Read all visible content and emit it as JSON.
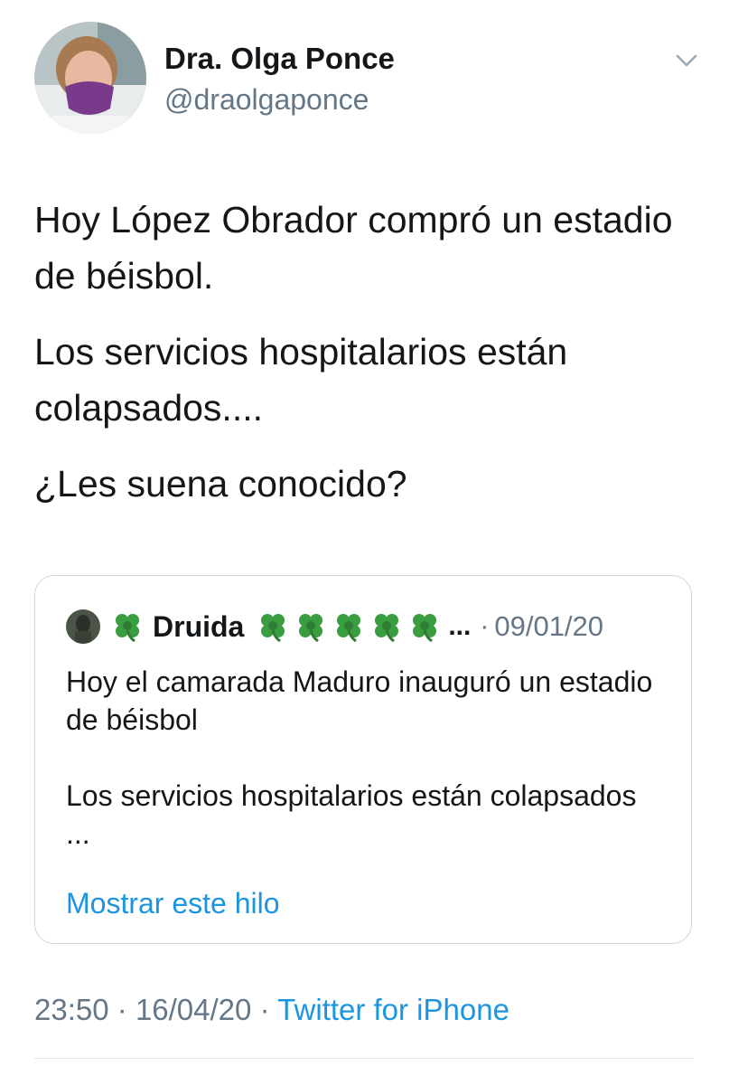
{
  "author": {
    "display_name": "Dra. Olga Ponce",
    "handle": "@draolgaponce",
    "avatar_icon": "profile-photo-masked-woman"
  },
  "menu_icon": "chevron-down-icon",
  "tweet": {
    "paragraphs": [
      "Hoy López Obrador compró un estadio de béisbol.",
      "Los servicios hospitalarios están colapsados....",
      "¿Les suena conocido?"
    ]
  },
  "quoted_tweet": {
    "display_name": "Druida",
    "name_emoji_icon": "four-leaf-clover-icon",
    "ellipsis": "...",
    "separator": "·",
    "date": "09/01/20",
    "paragraphs": [
      "Hoy el camarada Maduro inauguró un estadio de béisbol",
      "Los servicios hospitalarios están colapsados ..."
    ],
    "show_thread_label": "Mostrar este hilo"
  },
  "meta": {
    "time": "23:50",
    "separator": "·",
    "date": "16/04/20",
    "source": "Twitter for iPhone"
  },
  "colors": {
    "link": "#1b95e0",
    "secondary_text": "#657786",
    "border": "#ccd6dd",
    "clover": "#2e8b3a"
  }
}
